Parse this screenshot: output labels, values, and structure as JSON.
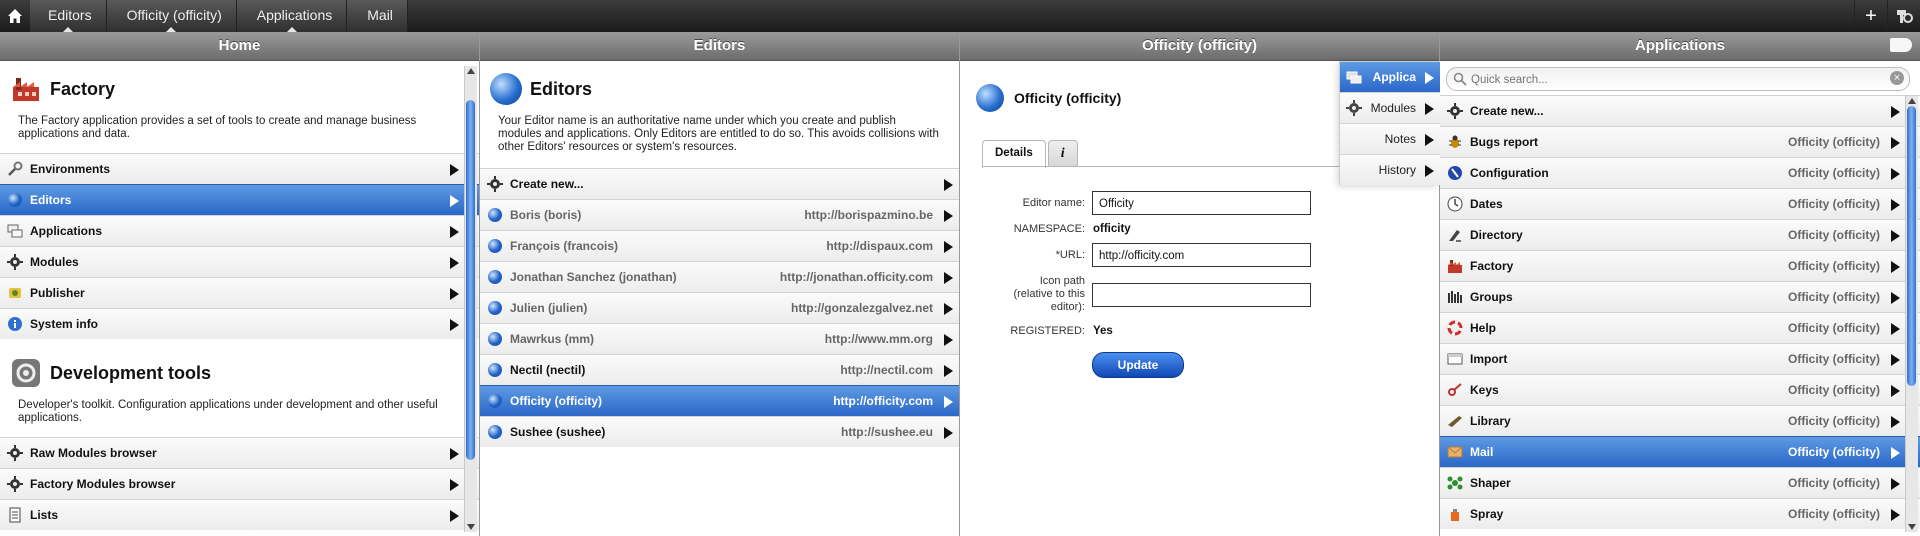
{
  "breadcrumbs": [
    "Editors",
    "Officity (officity)",
    "Applications",
    "Mail"
  ],
  "columns": {
    "home": {
      "title": "Home",
      "factory": {
        "heading": "Factory",
        "description": "The Factory application provides a set of tools to create and manage business applications and data."
      },
      "factory_items": [
        {
          "label": "Environments",
          "icon": "wrench-icon"
        },
        {
          "label": "Editors",
          "icon": "globe-icon",
          "selected": true
        },
        {
          "label": "Applications",
          "icon": "applications-icon"
        },
        {
          "label": "Modules",
          "icon": "gear-icon"
        },
        {
          "label": "Publisher",
          "icon": "publisher-icon"
        },
        {
          "label": "System info",
          "icon": "info-icon"
        }
      ],
      "devtools": {
        "heading": "Development tools",
        "description": "Developer's toolkit. Configuration applications under development and other useful applications."
      },
      "devtools_items": [
        {
          "label": "Raw Modules browser",
          "icon": "gear-icon"
        },
        {
          "label": "Factory Modules browser",
          "icon": "gear-icon"
        },
        {
          "label": "Lists",
          "icon": "list-icon"
        }
      ]
    },
    "editors": {
      "title": "Editors",
      "heading": "Editors",
      "description": "Your Editor name is an authoritative name under which you create and publish modules and applications. Only Editors are entitled to do so. This avoids collisions with other Editors' resources or system's resources.",
      "create_label": "Create new...",
      "items": [
        {
          "label": "Boris (boris)",
          "url": "http://borispazmino.be",
          "dim": true
        },
        {
          "label": "François (francois)",
          "url": "http://dispaux.com",
          "dim": true
        },
        {
          "label": "Jonathan Sanchez (jonathan)",
          "url": "http://jonathan.officity.com",
          "dim": true
        },
        {
          "label": "Julien (julien)",
          "url": "http://gonzalezgalvez.net",
          "dim": true
        },
        {
          "label": "Mawrkus (mm)",
          "url": "http://www.mm.org",
          "dim": true
        },
        {
          "label": "Nectil (nectil)",
          "url": "http://nectil.com",
          "dim": false
        },
        {
          "label": "Officity (officity)",
          "url": "http://officity.com",
          "selected": true
        },
        {
          "label": "Sushee (sushee)",
          "url": "http://sushee.eu",
          "dim": false
        }
      ]
    },
    "officity": {
      "title": "Officity (officity)",
      "heading": "Officity (officity)",
      "tabs": {
        "details": "Details",
        "info": "i"
      },
      "form": {
        "editor_name_label": "Editor name:",
        "editor_name_value": "Officity",
        "namespace_label": "NAMESPACE:",
        "namespace_value": "officity",
        "url_label": "*URL:",
        "url_value": "http://officity.com",
        "icon_path_label_1": "Icon path",
        "icon_path_label_2": "(relative to this",
        "icon_path_label_3": "editor):",
        "icon_path_value": "",
        "registered_label": "REGISTERED:",
        "registered_value": "Yes",
        "update_label": "Update"
      },
      "subnav": [
        {
          "label": "Applica",
          "selected": true,
          "icon": "applications-icon"
        },
        {
          "label": "Modules",
          "icon": "gear-icon"
        },
        {
          "label": "Notes"
        },
        {
          "label": "History"
        }
      ]
    },
    "applications": {
      "title": "Applications",
      "search_placeholder": "Quick search...",
      "create_label": "Create new...",
      "items": [
        {
          "label": "Bugs report",
          "value": "Officity (officity)",
          "icon": "bug-icon"
        },
        {
          "label": "Configuration",
          "value": "Officity (officity)",
          "icon": "configuration-icon"
        },
        {
          "label": "Dates",
          "value": "Officity (officity)",
          "icon": "clock-icon"
        },
        {
          "label": "Directory",
          "value": "Officity (officity)",
          "icon": "directory-icon"
        },
        {
          "label": "Factory",
          "value": "Officity (officity)",
          "icon": "factory-icon"
        },
        {
          "label": "Groups",
          "value": "Officity (officity)",
          "icon": "groups-icon"
        },
        {
          "label": "Help",
          "value": "Officity (officity)",
          "icon": "lifebuoy-icon"
        },
        {
          "label": "Import",
          "value": "Officity (officity)",
          "icon": "import-icon"
        },
        {
          "label": "Keys",
          "value": "Officity (officity)",
          "icon": "keys-icon"
        },
        {
          "label": "Library",
          "value": "Officity (officity)",
          "icon": "library-icon"
        },
        {
          "label": "Mail",
          "value": "Officity (officity)",
          "icon": "mail-icon",
          "selected": true
        },
        {
          "label": "Shaper",
          "value": "Officity (officity)",
          "icon": "shaper-icon"
        },
        {
          "label": "Spray",
          "value": "Officity (officity)",
          "icon": "spray-icon"
        }
      ]
    }
  },
  "colors": {
    "accent": "#2a67c8",
    "header": "#7a7a7a",
    "topbar": "#2a2a2a"
  }
}
